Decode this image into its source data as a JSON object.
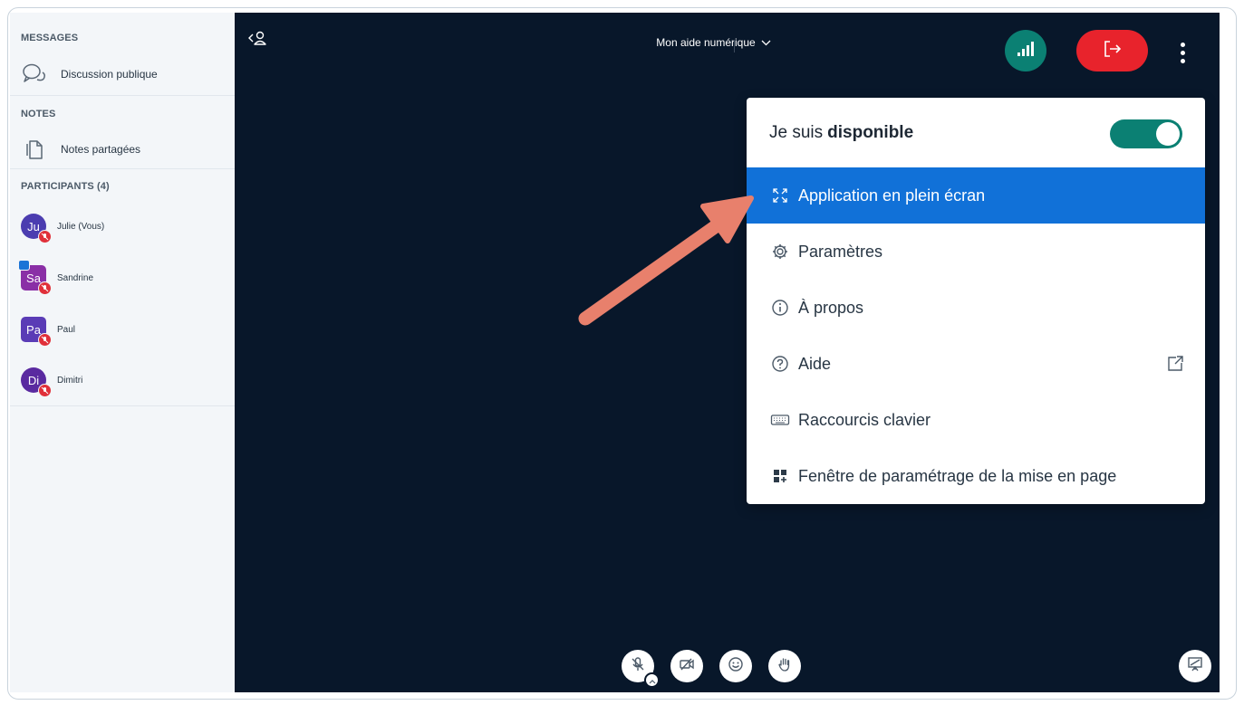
{
  "sidebar": {
    "messages_title": "MESSAGES",
    "public_chat": "Discussion publique",
    "notes_title": "NOTES",
    "shared_notes": "Notes partagées",
    "participants_title": "PARTICIPANTS (4)",
    "participants": [
      {
        "initials": "Ju",
        "name": "Julie (Vous)",
        "color": "#4b3db0",
        "shape": "round"
      },
      {
        "initials": "Sa",
        "name": "Sandrine",
        "color": "#8a2fa6",
        "shape": "square"
      },
      {
        "initials": "Pa",
        "name": "Paul",
        "color": "#5a3cb6",
        "shape": "square"
      },
      {
        "initials": "Di",
        "name": "Dimitri",
        "color": "#5a2aa0",
        "shape": "round"
      }
    ]
  },
  "header": {
    "meeting_title": "Mon aide numérique",
    "icons": {
      "hide_panel": "user-panel-icon",
      "connection": "signal-bars-icon",
      "leave": "leave-icon",
      "options": "more-vertical-icon"
    }
  },
  "menu": {
    "availability_prefix": "Je suis",
    "availability_bold": "disponible",
    "availability_on": true,
    "items": [
      {
        "label": "Application en plein écran",
        "icon": "fullscreen-icon",
        "active": true
      },
      {
        "label": "Paramètres",
        "icon": "gear-icon",
        "active": false
      },
      {
        "label": "À propos",
        "icon": "info-icon",
        "active": false
      },
      {
        "label": "Aide",
        "icon": "help-icon",
        "active": false
      },
      {
        "label": "Raccourcis clavier",
        "icon": "keyboard-icon",
        "active": false
      },
      {
        "label": "Fenêtre de paramétrage de la mise en page",
        "icon": "layout-icon",
        "active": false
      }
    ]
  },
  "colors": {
    "stage_bg": "#08172a",
    "sidebar_bg": "#f3f6f9",
    "accent_blue": "#1171d8",
    "accent_teal": "#0b8073",
    "leave_red": "#e8232c",
    "arrow": "#e8806c"
  }
}
